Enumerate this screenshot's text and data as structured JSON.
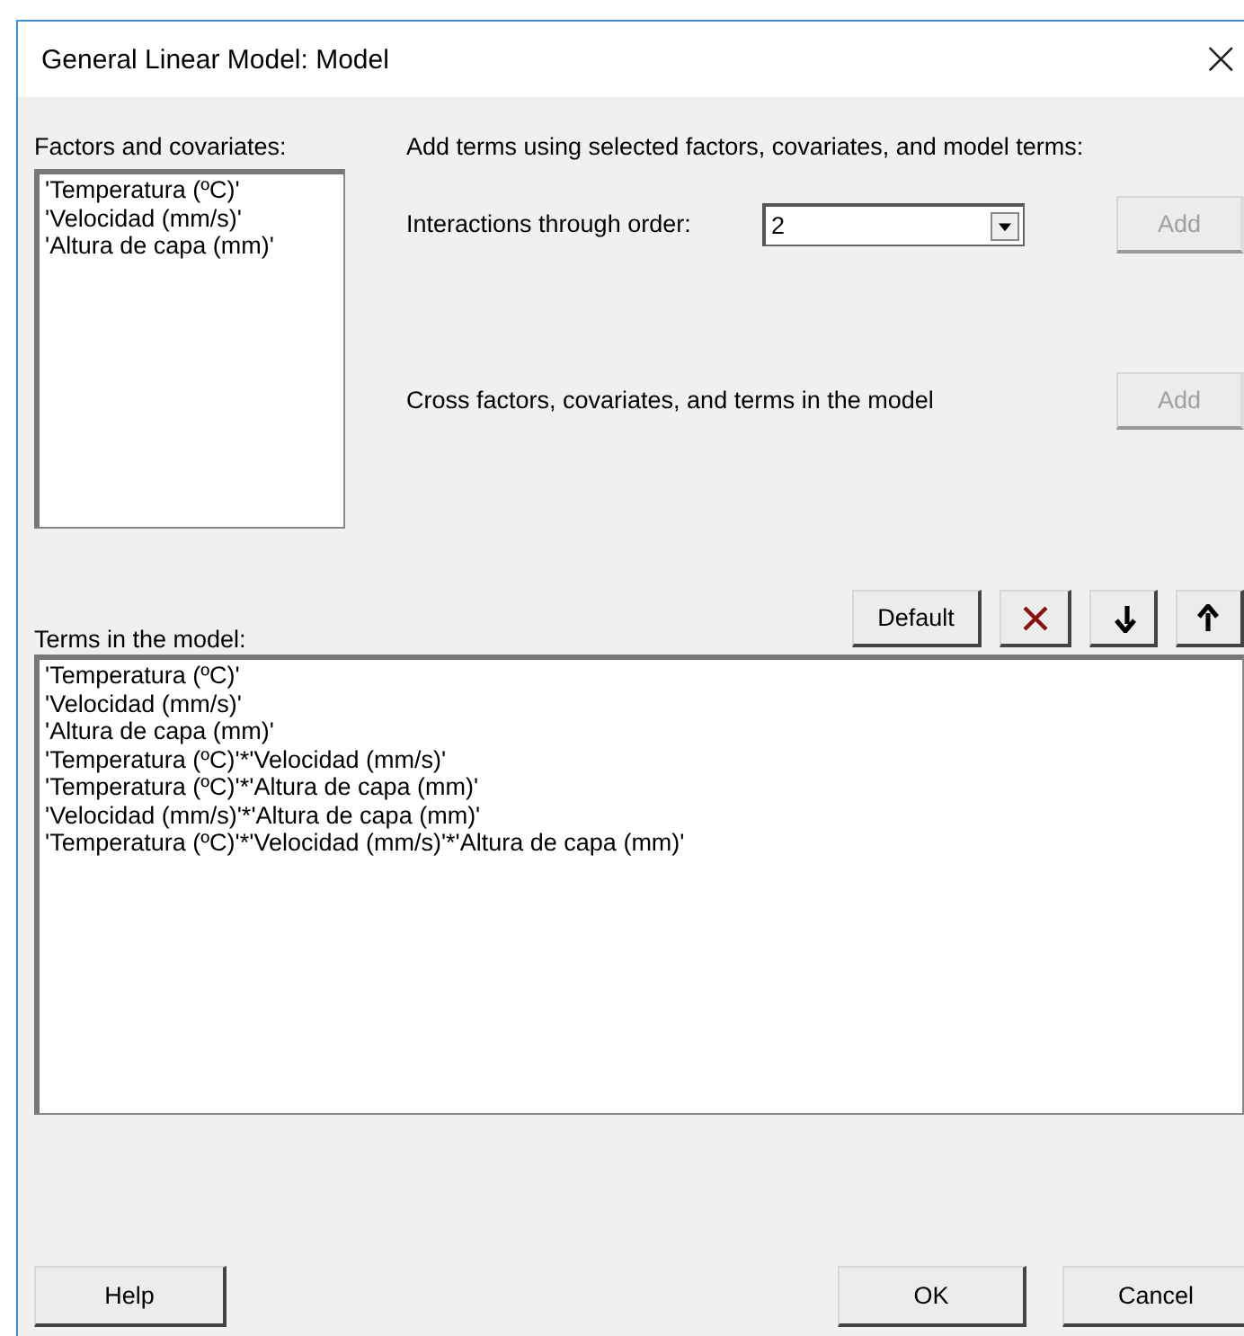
{
  "window": {
    "title": "General Linear Model: Model",
    "close": "×"
  },
  "factors": {
    "label": "Factors and covariates:",
    "items": [
      "'Temperatura (ºC)'",
      "'Velocidad (mm/s)'",
      "'Altura de capa (mm)'"
    ]
  },
  "add_terms": {
    "heading": "Add terms using selected factors, covariates, and model terms:",
    "interactions": {
      "label": "Interactions through order:",
      "value": "2",
      "button": {
        "label": "Add",
        "disabled": true
      }
    },
    "cross": {
      "label": "Cross factors, covariates, and terms in the model",
      "button": {
        "label": "Add",
        "disabled": true
      }
    }
  },
  "term_tools": [
    {
      "kind": "text",
      "label": "Default"
    },
    {
      "kind": "delete"
    },
    {
      "kind": "down"
    },
    {
      "kind": "up"
    }
  ],
  "terms": {
    "label": "Terms in the model:",
    "items": [
      "'Temperatura (ºC)'",
      "'Velocidad (mm/s)'",
      "'Altura de capa (mm)'",
      "'Temperatura (ºC)'*'Velocidad (mm/s)'",
      "'Temperatura (ºC)'*'Altura de capa (mm)'",
      "'Velocidad (mm/s)'*'Altura de capa (mm)'",
      "'Temperatura (ºC)'*'Velocidad (mm/s)'*'Altura de capa (mm)'"
    ]
  },
  "buttons": [
    {
      "label": "Help"
    },
    {
      "label": "OK"
    },
    {
      "label": "Cancel"
    }
  ]
}
